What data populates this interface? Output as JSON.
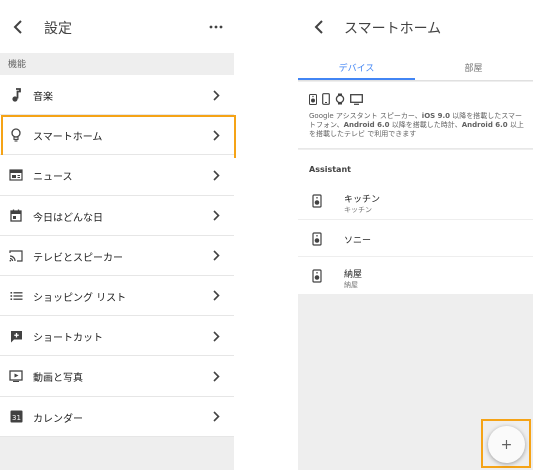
{
  "left": {
    "title": "設定",
    "section": "機能",
    "items": [
      {
        "label": "音楽",
        "icon": "music-note-icon"
      },
      {
        "label": "スマートホーム",
        "icon": "lightbulb-icon"
      },
      {
        "label": "ニュース",
        "icon": "news-icon"
      },
      {
        "label": "今日はどんな日",
        "icon": "calendar-day-icon"
      },
      {
        "label": "テレビとスピーカー",
        "icon": "cast-icon"
      },
      {
        "label": "ショッピング リスト",
        "icon": "list-icon"
      },
      {
        "label": "ショートカット",
        "icon": "shortcut-icon"
      },
      {
        "label": "動画と写真",
        "icon": "video-icon"
      },
      {
        "label": "カレンダー",
        "icon": "calendar-icon"
      }
    ],
    "calendar_day": "31",
    "highlight_color": "#f5a316"
  },
  "right": {
    "title": "スマートホーム",
    "tabs": [
      "デバイス",
      "部屋"
    ],
    "device_desc": {
      "t1": "Google",
      "t2": " アシスタント スピーカー、",
      "t3": "iOS 9.0",
      "t4": " 以降を搭載したスマートフォン、",
      "t5": "Android 6.0",
      "t6": " 以降を搭載した時計、",
      "t7": "Android 6.0",
      "t8": " 以上を搭載したテレビ で利用できます"
    },
    "section": "Assistant",
    "devices": [
      {
        "name": "キッチン",
        "sub": "キッチン"
      },
      {
        "name": "ソニー",
        "sub": ""
      },
      {
        "name": "納屋",
        "sub": "納屋"
      }
    ],
    "fab_label": "+",
    "accent_color": "#4285f4"
  }
}
